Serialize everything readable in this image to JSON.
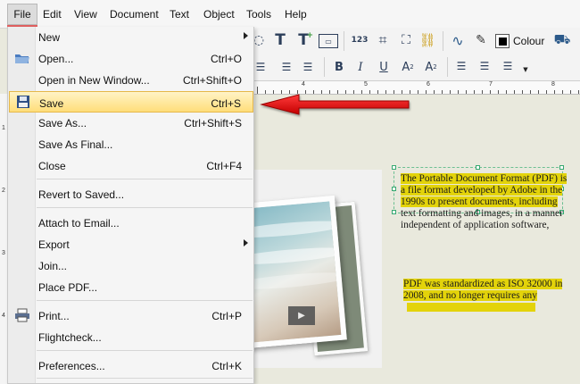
{
  "menubar": [
    "File",
    "Edit",
    "View",
    "Document",
    "Text",
    "Object",
    "Tools",
    "Help"
  ],
  "file_menu": {
    "items": [
      {
        "label": "New",
        "shortcut": "",
        "submenu": true
      },
      {
        "label": "Open...",
        "shortcut": "Ctrl+O",
        "icon": "folder-icon"
      },
      {
        "label": "Open in New Window...",
        "shortcut": "Ctrl+Shift+O"
      },
      {
        "label": "Save",
        "shortcut": "Ctrl+S",
        "icon": "floppy-icon",
        "highlighted": true
      },
      {
        "label": "Save As...",
        "shortcut": "Ctrl+Shift+S"
      },
      {
        "label": "Save As Final...",
        "shortcut": ""
      },
      {
        "label": "Close",
        "shortcut": "Ctrl+F4"
      },
      {
        "label": "Revert to Saved...",
        "shortcut": ""
      },
      {
        "label": "Attach to Email...",
        "shortcut": ""
      },
      {
        "label": "Export",
        "shortcut": "",
        "submenu": true
      },
      {
        "label": "Join...",
        "shortcut": ""
      },
      {
        "label": "Place PDF...",
        "shortcut": ""
      },
      {
        "label": "Print...",
        "shortcut": "Ctrl+P",
        "icon": "printer-icon"
      },
      {
        "label": "Flightcheck...",
        "shortcut": ""
      },
      {
        "label": "Preferences...",
        "shortcut": "Ctrl+K"
      }
    ]
  },
  "toolbar": {
    "colour_label": "Colour",
    "format_buttons": [
      "B",
      "I",
      "U",
      "A",
      "A"
    ],
    "superscript": "2",
    "subscript": "2",
    "numbering": "123"
  },
  "ruler": {
    "top": [
      "4",
      "5",
      "6",
      "7",
      "8"
    ],
    "left": [
      "1",
      "2",
      "3",
      "4"
    ]
  },
  "document": {
    "para1": [
      "The Portable Document Format (PDF) is",
      "a file format developed by Adobe in the",
      "1990s to present documents, including",
      "text formatting and images, in a manner",
      "independent of application software,"
    ],
    "para2": [
      "PDF was standardized as ISO 32000 in",
      "2008, and no longer requires any"
    ]
  },
  "colors": {
    "highlight": "#e3d30a",
    "menu_active": "#ffde7a",
    "annotation_arrow": "#e01414"
  }
}
